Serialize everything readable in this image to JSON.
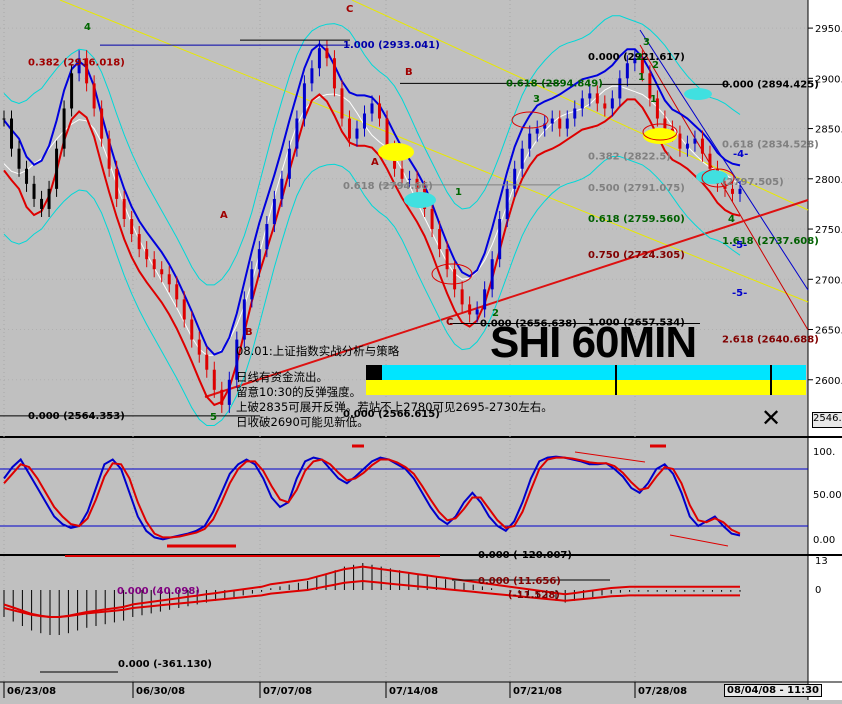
{
  "chart_data": {
    "type": "candlestick",
    "title": "SHI 60MIN",
    "annotation": {
      "header": "08.01:上证指数实战分析与策略",
      "lines": [
        "日线有资金流出。",
        "留意10:30的反弹强度。",
        "上破2835可展开反弹。若站不上2780可见2695-2730左右。",
        "日收破2690可能见新低。"
      ]
    },
    "x_ticks": [
      "06/23/08",
      "06/30/08",
      "07/07/08",
      "07/14/08",
      "07/21/08",
      "07/28/08"
    ],
    "date_box": "08/04/08 - 11:30",
    "y_ticks": [
      2950,
      2900,
      2850,
      2800,
      2750,
      2700,
      2650,
      2600
    ],
    "ylim": [
      2550,
      2970
    ],
    "last_price": "2546.",
    "close_series": [
      2860,
      2830,
      2810,
      2795,
      2780,
      2770,
      2790,
      2830,
      2870,
      2905,
      2920,
      2895,
      2870,
      2840,
      2810,
      2780,
      2760,
      2745,
      2730,
      2720,
      2710,
      2705,
      2695,
      2680,
      2660,
      2640,
      2625,
      2610,
      2590,
      2575,
      2600,
      2640,
      2680,
      2710,
      2730,
      2755,
      2780,
      2800,
      2830,
      2860,
      2895,
      2910,
      2930,
      2920,
      2890,
      2860,
      2840,
      2850,
      2865,
      2875,
      2860,
      2830,
      2810,
      2800,
      2800,
      2790,
      2770,
      2750,
      2730,
      2710,
      2690,
      2675,
      2665,
      2670,
      2690,
      2720,
      2760,
      2790,
      2810,
      2830,
      2845,
      2850,
      2855,
      2860,
      2850,
      2860,
      2870,
      2880,
      2885,
      2875,
      2870,
      2880,
      2900,
      2915,
      2920,
      2905,
      2880,
      2860,
      2850,
      2845,
      2830,
      2835,
      2840,
      2825,
      2810,
      2795,
      2790,
      2785,
      2790
    ],
    "fib_labels_left": [
      {
        "text": "0.382 (2916.018)",
        "y": 2916
      },
      {
        "text": "0.000 (2564.353)",
        "y": 2564
      }
    ],
    "fib_labels_mid": [
      {
        "text": "1.000 (2933.041)",
        "y": 2933
      },
      {
        "text": "0.618 (2794.66)",
        "y": 2793
      },
      {
        "text": "0.618 (2894.849)",
        "y": 2895
      },
      {
        "text": "0.000 (2566.615)",
        "y": 2566
      }
    ],
    "fib_labels_right": [
      {
        "text": "0.000 (2921.617)",
        "y": 2921,
        "color": "#000000"
      },
      {
        "text": "0.000 (2894.425)",
        "y": 2894,
        "color": "#000000"
      },
      {
        "text": "0.618 (2834.528)",
        "y": 2834,
        "color": "#808080"
      },
      {
        "text": "0.382 (2822.5)",
        "y": 2822,
        "color": "#808080"
      },
      {
        "text": "0.500 (2791.075)",
        "y": 2791,
        "color": "#808080"
      },
      {
        "text": "(2797.505)",
        "y": 2797,
        "color": "#808080"
      },
      {
        "text": "0.618 (2759.560)",
        "y": 2760,
        "color": "#006000"
      },
      {
        "text": "1.618 (2737.608)",
        "y": 2738,
        "color": "#006000"
      },
      {
        "text": "0.750 (2724.305)",
        "y": 2724,
        "color": "#800000"
      },
      {
        "text": "0.000 (2656.638)",
        "y": 2656,
        "color": "#000000"
      },
      {
        "text": "1.000 (2657.534)",
        "y": 2657,
        "color": "#000000"
      },
      {
        "text": "2.618 (2640.688)",
        "y": 2640,
        "color": "#800000"
      }
    ],
    "wave_labels": [
      "4",
      "5",
      "A",
      "B",
      "C",
      "A",
      "B",
      "C",
      "1",
      "2",
      "3",
      "1",
      "2",
      "1",
      "2",
      "3",
      "4",
      "-4-",
      "-5-",
      "-5-"
    ],
    "stochastic": {
      "ticks": [
        "100.",
        "50.00",
        "0.00"
      ],
      "k": [
        70,
        82,
        90,
        75,
        60,
        45,
        30,
        22,
        18,
        20,
        35,
        60,
        85,
        90,
        80,
        55,
        30,
        15,
        8,
        6,
        8,
        10,
        12,
        15,
        20,
        35,
        55,
        75,
        85,
        90,
        85,
        70,
        50,
        40,
        45,
        70,
        88,
        92,
        90,
        80,
        70,
        65,
        72,
        80,
        88,
        92,
        90,
        85,
        80,
        70,
        55,
        40,
        28,
        22,
        30,
        45,
        55,
        45,
        30,
        20,
        15,
        25,
        45,
        70,
        88,
        92,
        93,
        92,
        90,
        88,
        85,
        85,
        86,
        80,
        72,
        60,
        55,
        65,
        80,
        85,
        75,
        55,
        30,
        20,
        25,
        30,
        20,
        12,
        10
      ],
      "d": [
        65,
        75,
        85,
        82,
        70,
        55,
        40,
        30,
        22,
        20,
        28,
        48,
        72,
        86,
        85,
        70,
        45,
        25,
        12,
        8,
        8,
        9,
        11,
        13,
        17,
        27,
        45,
        65,
        80,
        88,
        88,
        78,
        62,
        48,
        45,
        58,
        78,
        88,
        90,
        85,
        76,
        68,
        70,
        76,
        84,
        90,
        90,
        87,
        82,
        75,
        62,
        48,
        35,
        26,
        28,
        38,
        50,
        50,
        38,
        26,
        18,
        20,
        35,
        58,
        80,
        90,
        92,
        92,
        91,
        89,
        87,
        86,
        86,
        83,
        76,
        66,
        58,
        60,
        72,
        82,
        80,
        65,
        42,
        26,
        24,
        28,
        24,
        16,
        12
      ]
    },
    "macd": {
      "ticks": [
        "13",
        "0"
      ],
      "labels": [
        {
          "text": "0.000 (40.098)",
          "color": "#800080"
        },
        {
          "text": "0.000 (-361.130)",
          "color": "#000000"
        },
        {
          "text": "0.000 (11.656)",
          "color": "#800000"
        },
        {
          "text": "(-11.528)",
          "color": "#800000"
        },
        {
          "text": "0.000 (-120.007)",
          "color": "#000000"
        }
      ],
      "hist": [
        -30,
        -35,
        -40,
        -45,
        -48,
        -50,
        -50,
        -48,
        -45,
        -42,
        -40,
        -38,
        -36,
        -34,
        -30,
        -28,
        -26,
        -24,
        -22,
        -20,
        -18,
        -16,
        -14,
        -12,
        -10,
        -8,
        -6,
        -4,
        -2,
        2,
        4,
        6,
        8,
        10,
        14,
        18,
        22,
        26,
        28,
        30,
        28,
        26,
        24,
        22,
        20,
        18,
        16,
        14,
        12,
        10,
        8,
        6,
        4,
        2,
        0,
        -2,
        -4,
        -6,
        -8,
        -10,
        -12,
        -14,
        -12,
        -10,
        -8,
        -6,
        -4,
        -3,
        -2,
        -2,
        -2,
        -2,
        -2,
        -2,
        -2,
        -2,
        -2,
        -2,
        -2,
        -2,
        -2
      ]
    }
  }
}
